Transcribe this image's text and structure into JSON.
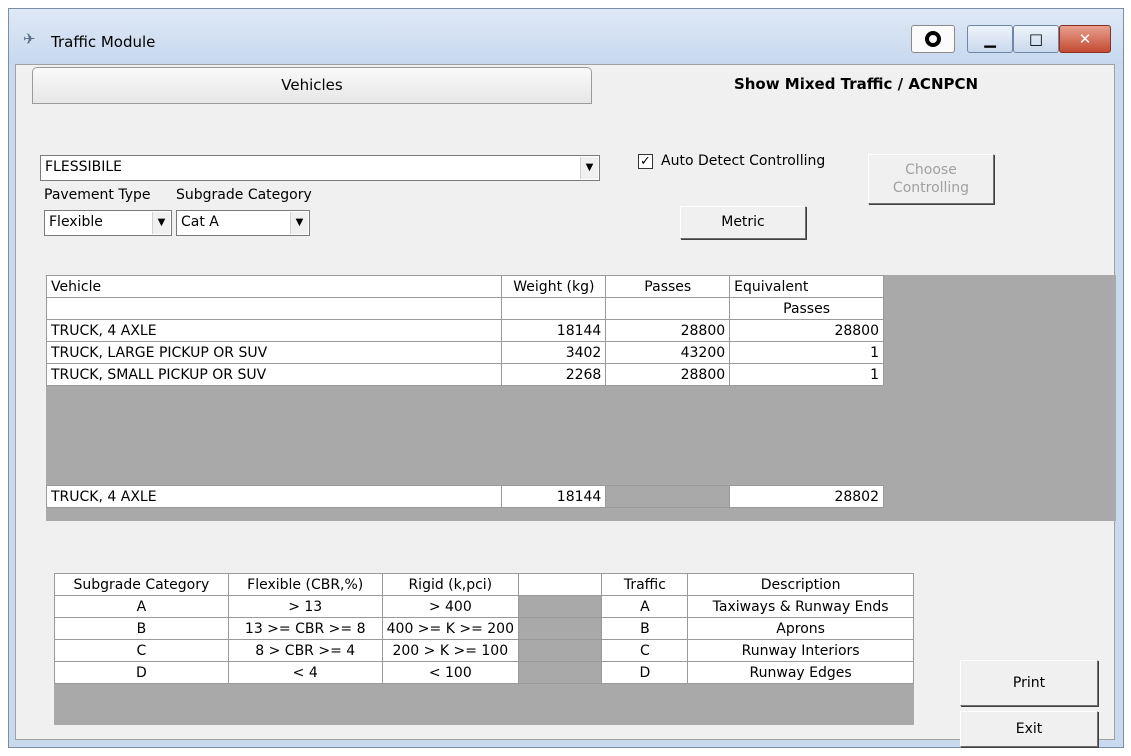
{
  "window": {
    "title": "Traffic Module"
  },
  "tabs": {
    "vehicles": "Vehicles",
    "mixed": "Show Mixed Traffic / ACNPCN"
  },
  "section": {
    "value": "FLESSIBILE"
  },
  "pavement": {
    "label": "Pavement Type",
    "value": "Flexible"
  },
  "subgrade": {
    "label": "Subgrade Category",
    "value": "Cat A"
  },
  "auto_detect": {
    "label": "Auto Detect Controlling",
    "checked": true
  },
  "buttons": {
    "choose_line1": "Choose",
    "choose_line2": "Controlling",
    "metric": "Metric",
    "print": "Print",
    "exit": "Exit"
  },
  "vehicle_table": {
    "headers": {
      "vehicle": "Vehicle",
      "weight": "Weight (kg)",
      "passes": "Passes",
      "equivalent": "Equivalent",
      "equivalent2": "Passes"
    },
    "rows": [
      {
        "vehicle": "TRUCK, 4 AXLE",
        "weight": "18144",
        "passes": "28800",
        "equivalent": "28800"
      },
      {
        "vehicle": "TRUCK, LARGE PICKUP OR SUV",
        "weight": "3402",
        "passes": "43200",
        "equivalent": "1"
      },
      {
        "vehicle": "TRUCK, SMALL PICKUP OR SUV",
        "weight": "2268",
        "passes": "28800",
        "equivalent": "1"
      }
    ],
    "total": {
      "vehicle": "TRUCK, 4 AXLE",
      "weight": "18144",
      "passes": "",
      "equivalent": "28802"
    }
  },
  "category_table": {
    "headers": {
      "subgrade": "Subgrade Category",
      "flexible": "Flexible (CBR,%)",
      "rigid": "Rigid (k,pci)",
      "traffic": "Traffic",
      "description": "Description"
    },
    "rows": [
      {
        "subgrade": "A",
        "flexible": "> 13",
        "rigid": "> 400",
        "traffic": "A",
        "description": "Taxiways & Runway Ends"
      },
      {
        "subgrade": "B",
        "flexible": "13 >= CBR >= 8",
        "rigid": "400 >= K >= 200",
        "traffic": "B",
        "description": "Aprons"
      },
      {
        "subgrade": "C",
        "flexible": "8 > CBR >= 4",
        "rigid": "200 > K >= 100",
        "traffic": "C",
        "description": "Runway Interiors"
      },
      {
        "subgrade": "D",
        "flexible": "< 4",
        "rigid": "< 100",
        "traffic": "D",
        "description": "Runway Edges"
      }
    ]
  }
}
